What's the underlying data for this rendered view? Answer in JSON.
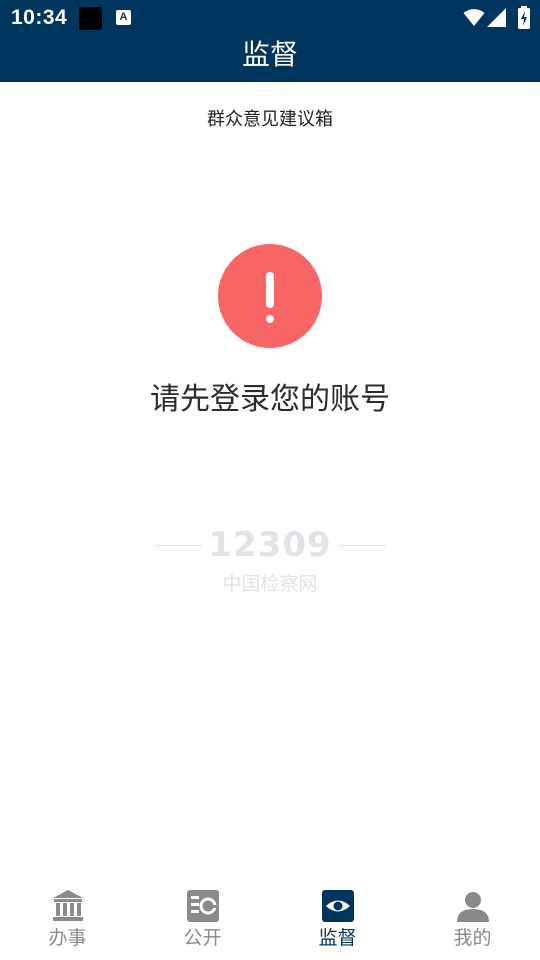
{
  "status_bar": {
    "time": "10:34",
    "notif_letter": "A"
  },
  "header": {
    "title": "监督"
  },
  "subtitle": "群众意见建议箱",
  "alert": {
    "message": "请先登录您的账号"
  },
  "watermark": {
    "number": "12309",
    "text": "中国检察网"
  },
  "tabs": [
    {
      "label": "办事",
      "icon": "bank-icon",
      "active": false
    },
    {
      "label": "公开",
      "icon": "disclosure-icon",
      "active": false
    },
    {
      "label": "监督",
      "icon": "eye-icon",
      "active": true
    },
    {
      "label": "我的",
      "icon": "user-icon",
      "active": false
    }
  ],
  "colors": {
    "header_bg": "#00355e",
    "alert_red": "#f76664",
    "tab_active": "#00355e",
    "tab_inactive": "#8a8a8a"
  }
}
